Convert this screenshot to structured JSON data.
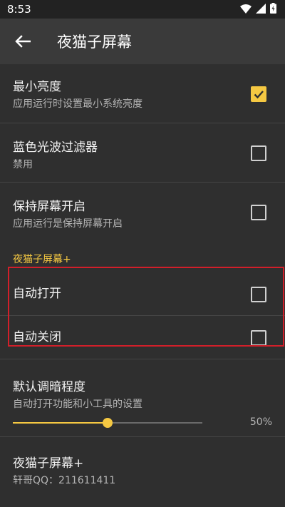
{
  "status_bar": {
    "time": "8:53",
    "icons": [
      "wifi-icon",
      "signal-icon",
      "battery-charging-icon"
    ]
  },
  "app_bar": {
    "back_icon": "arrow-back-icon",
    "title": "夜猫子屏幕"
  },
  "preferences": {
    "min_brightness": {
      "title": "最小亮度",
      "summary": "应用运行时设置最小系统亮度",
      "checked": true
    },
    "blue_filter": {
      "title": "蓝色光波过滤器",
      "summary": "禁用",
      "checked": false
    },
    "keep_screen_on": {
      "title": "保持屏幕开启",
      "summary": "应用运行是保持屏幕开启",
      "checked": false
    }
  },
  "plus_section": {
    "category": "夜猫子屏幕+",
    "auto_open": {
      "title": "自动打开",
      "checked": false
    },
    "auto_close": {
      "title": "自动关闭",
      "checked": false
    }
  },
  "dim_level": {
    "title": "默认调暗程度",
    "summary": "自动打开功能和小工具的设置",
    "value": 0.5,
    "value_label": "50%"
  },
  "about": {
    "title": "夜猫子屏幕+",
    "summary": "轩哥QQ：211611411"
  },
  "colors": {
    "accent": "#f5c842",
    "background": "#2f2f2f",
    "app_bar": "#3a3a3a",
    "highlight": "#d21f2a"
  }
}
